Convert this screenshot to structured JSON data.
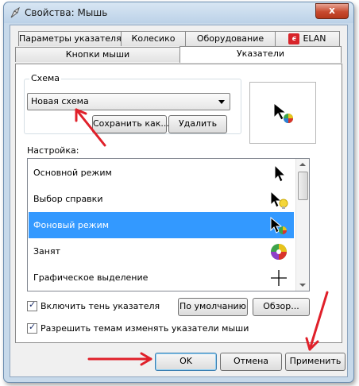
{
  "window": {
    "title": "Свойства: Мышь",
    "close_label": "x"
  },
  "tabs_row1": [
    {
      "label": "Параметры указателя"
    },
    {
      "label": "Колесико"
    },
    {
      "label": "Оборудование"
    },
    {
      "label": "ELAN"
    }
  ],
  "tabs_row2": [
    {
      "label": "Кнопки мыши"
    },
    {
      "label": "Указатели",
      "active": true
    }
  ],
  "scheme": {
    "legend": "Схема",
    "selected": "Новая схема",
    "save_as_label": "Сохранить как...",
    "delete_label": "Удалить"
  },
  "settings": {
    "label": "Настройка:",
    "items": [
      {
        "label": "Основной режим",
        "icon": "arrow-cursor-icon"
      },
      {
        "label": "Выбор справки",
        "icon": "help-select-cursor-icon"
      },
      {
        "label": "Фоновый режим",
        "icon": "working-in-background-cursor-icon",
        "selected": true
      },
      {
        "label": "Занят",
        "icon": "busy-cursor-icon"
      },
      {
        "label": "Графическое выделение",
        "icon": "precision-select-cursor-icon"
      }
    ]
  },
  "options": {
    "shadow_label": "Включить тень указателя",
    "shadow_checked": true,
    "default_label": "По умолчанию",
    "browse_label": "Обзор...",
    "themes_label": "Разрешить темам изменять указатели мыши",
    "themes_checked": true
  },
  "footer": {
    "ok_label": "OK",
    "cancel_label": "Отмена",
    "apply_label": "Применить"
  },
  "colors": {
    "selection": "#3399ff",
    "annotation_arrow": "#e0202a"
  }
}
